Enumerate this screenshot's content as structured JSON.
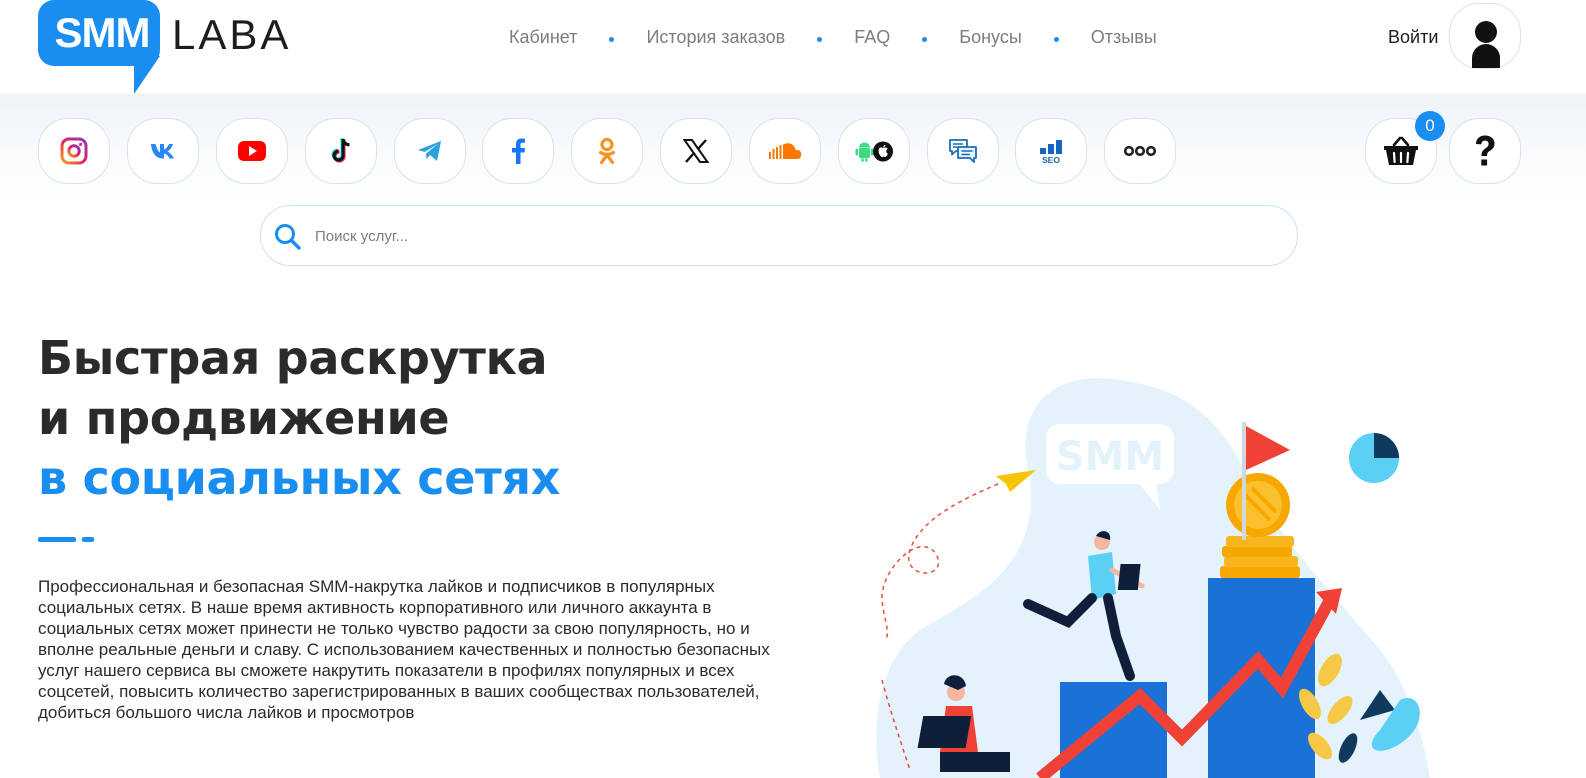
{
  "header": {
    "logo": {
      "left_text": "SMM",
      "right_text": "LABA"
    },
    "nav": [
      {
        "label": "Кабинет"
      },
      {
        "label": "История заказов"
      },
      {
        "label": "FAQ"
      },
      {
        "label": "Бонусы"
      },
      {
        "label": "Отзывы"
      }
    ],
    "login_label": "Войти"
  },
  "socials": [
    {
      "name": "instagram-icon"
    },
    {
      "name": "vk-icon"
    },
    {
      "name": "youtube-icon"
    },
    {
      "name": "tiktok-icon"
    },
    {
      "name": "telegram-icon"
    },
    {
      "name": "facebook-icon"
    },
    {
      "name": "odnoklassniki-icon"
    },
    {
      "name": "x-icon"
    },
    {
      "name": "soundcloud-icon"
    },
    {
      "name": "android-apple-icon"
    },
    {
      "name": "chat-icon"
    },
    {
      "name": "seo-icon"
    },
    {
      "name": "more-icon"
    }
  ],
  "cart": {
    "count": "0"
  },
  "help": {
    "icon": "question-icon"
  },
  "search": {
    "placeholder": "Поиск услуг..."
  },
  "hero": {
    "title_line1": "Быстрая раскрутка",
    "title_line2": "и продвижение",
    "title_line3": "в социальных сетях",
    "description": "Профессиональная и безопасная SMM-накрутка лайков и подписчиков в популярных социальных сетях. В наше время активность корпоративного или личного аккаунта в социальных сетях может принести не только чувство радости за свою популярность, но и вполне реальные деньги и славу. С использованием качественных и полностью безопасных услуг нашего сервиса вы сможете накрутить показатели в профилях популярных и всех соцсетей, повысить количество зарегистрированных в ваших сообществах пользователей, добиться большого числа лайков и просмотров",
    "illustration_badge": "SMM"
  },
  "colors": {
    "accent": "#1a8ef0",
    "text": "#2b2b2b",
    "nav_text": "#7d7d7d"
  }
}
